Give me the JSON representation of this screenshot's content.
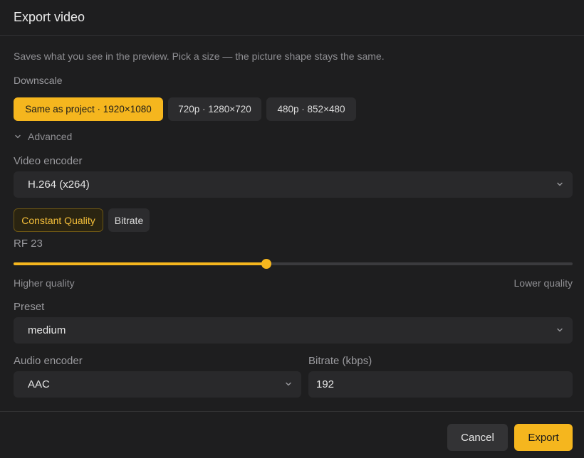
{
  "dialog": {
    "title": "Export video",
    "description": "Saves what you see in the preview. Pick a size — the picture shape stays the same."
  },
  "downscale": {
    "label": "Downscale",
    "options": [
      {
        "label": "Same as project · 1920×1080",
        "selected": true
      },
      {
        "label": "720p · 1280×720",
        "selected": false
      },
      {
        "label": "480p · 852×480",
        "selected": false
      }
    ]
  },
  "advanced": {
    "label": "Advanced",
    "expanded": true,
    "icon": "chevron-down-icon"
  },
  "video_encoder": {
    "label": "Video encoder",
    "value": "H.264 (x264)"
  },
  "rate_mode": {
    "options": [
      {
        "label": "Constant Quality",
        "selected": true
      },
      {
        "label": "Bitrate",
        "selected": false
      }
    ]
  },
  "quality": {
    "label": "RF 23",
    "value_fraction": 0.452,
    "low_hint": "Higher quality",
    "high_hint": "Lower quality"
  },
  "preset": {
    "label": "Preset",
    "value": "medium"
  },
  "audio_encoder": {
    "label": "Audio encoder",
    "value": "AAC"
  },
  "audio_bitrate": {
    "label": "Bitrate (kbps)",
    "value": "192"
  },
  "footer": {
    "cancel_label": "Cancel",
    "export_label": "Export"
  },
  "colors": {
    "accent": "#f5b61e",
    "background": "#1e1e1f",
    "surface": "#29292b"
  }
}
